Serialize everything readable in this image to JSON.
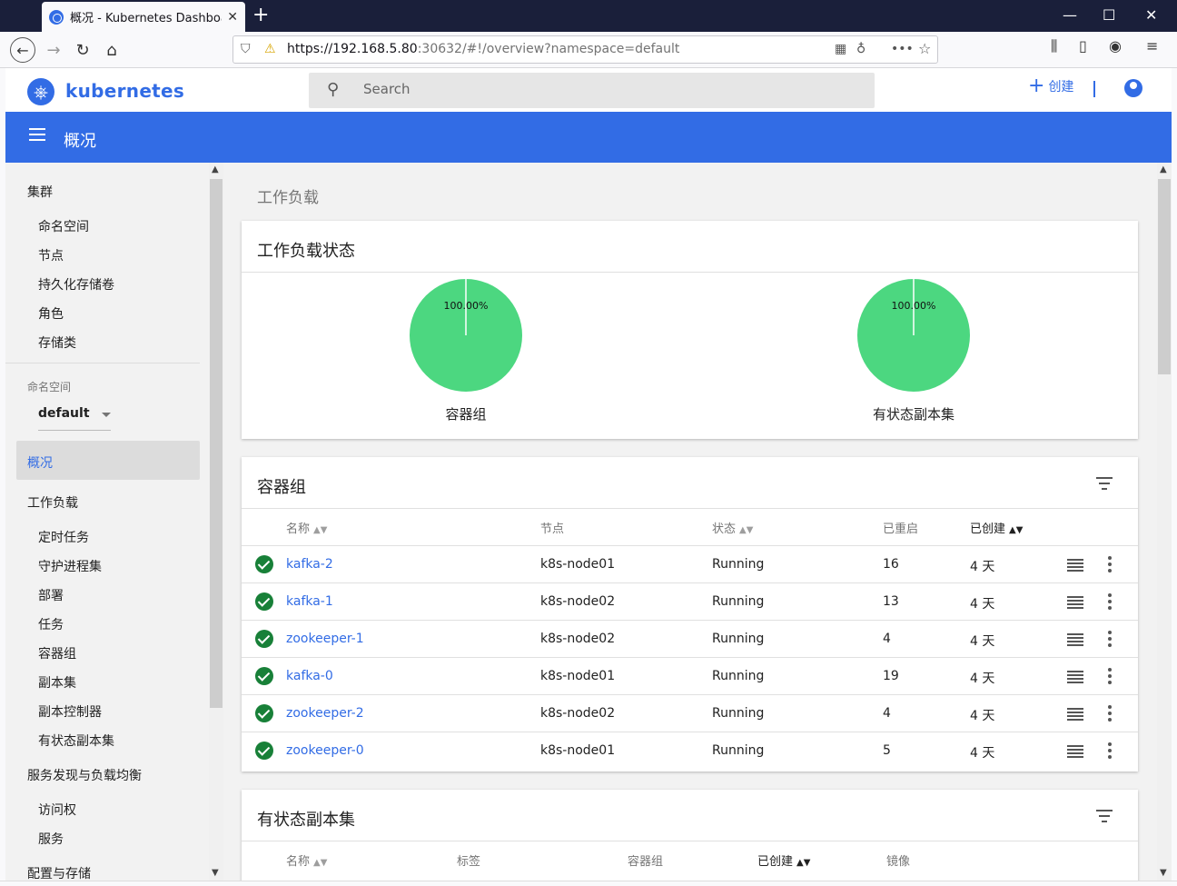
{
  "browser": {
    "tab_title": "概况 - Kubernetes Dashboard",
    "url_host": "https://192.168.5.80",
    "url_rest": ":30632/#!/overview?namespace=default"
  },
  "header": {
    "brand": "kubernetes",
    "search_placeholder": "Search",
    "create_label": "创建"
  },
  "toolbar": {
    "title": "概况"
  },
  "sidebar": {
    "cluster": "集群",
    "cluster_items": [
      "命名空间",
      "节点",
      "持久化存储卷",
      "角色",
      "存储类"
    ],
    "namespace_label": "命名空间",
    "namespace_value": "default",
    "overview": "概况",
    "workloads": "工作负载",
    "workload_items": [
      "定时任务",
      "守护进程集",
      "部署",
      "任务",
      "容器组",
      "副本集",
      "副本控制器",
      "有状态副本集"
    ],
    "discovery": "服务发现与负载均衡",
    "discovery_items": [
      "访问权",
      "服务"
    ],
    "config": "配置与存储"
  },
  "main": {
    "section_title": "工作负载",
    "status_card": {
      "title": "工作负载状态",
      "charts": [
        {
          "name": "容器组",
          "percent_label": "100.00%",
          "running_fraction": 1.0
        },
        {
          "name": "有状态副本集",
          "percent_label": "100.00%",
          "running_fraction": 1.0
        }
      ]
    },
    "pods_card": {
      "title": "容器组",
      "columns": [
        "名称",
        "节点",
        "状态",
        "已重启",
        "已创建"
      ],
      "rows": [
        {
          "name": "kafka-2",
          "node": "k8s-node01",
          "status": "Running",
          "restarts": "16",
          "age": "4 天"
        },
        {
          "name": "kafka-1",
          "node": "k8s-node02",
          "status": "Running",
          "restarts": "13",
          "age": "4 天"
        },
        {
          "name": "zookeeper-1",
          "node": "k8s-node02",
          "status": "Running",
          "restarts": "4",
          "age": "4 天"
        },
        {
          "name": "kafka-0",
          "node": "k8s-node01",
          "status": "Running",
          "restarts": "19",
          "age": "4 天"
        },
        {
          "name": "zookeeper-2",
          "node": "k8s-node02",
          "status": "Running",
          "restarts": "4",
          "age": "4 天"
        },
        {
          "name": "zookeeper-0",
          "node": "k8s-node01",
          "status": "Running",
          "restarts": "5",
          "age": "4 天"
        }
      ]
    },
    "statefulsets_card": {
      "title": "有状态副本集",
      "columns": [
        "名称",
        "标签",
        "容器组",
        "已创建",
        "镜像"
      ]
    }
  },
  "colors": {
    "accent": "#326ce5",
    "pie": "#4cd780",
    "ok": "#188038"
  }
}
